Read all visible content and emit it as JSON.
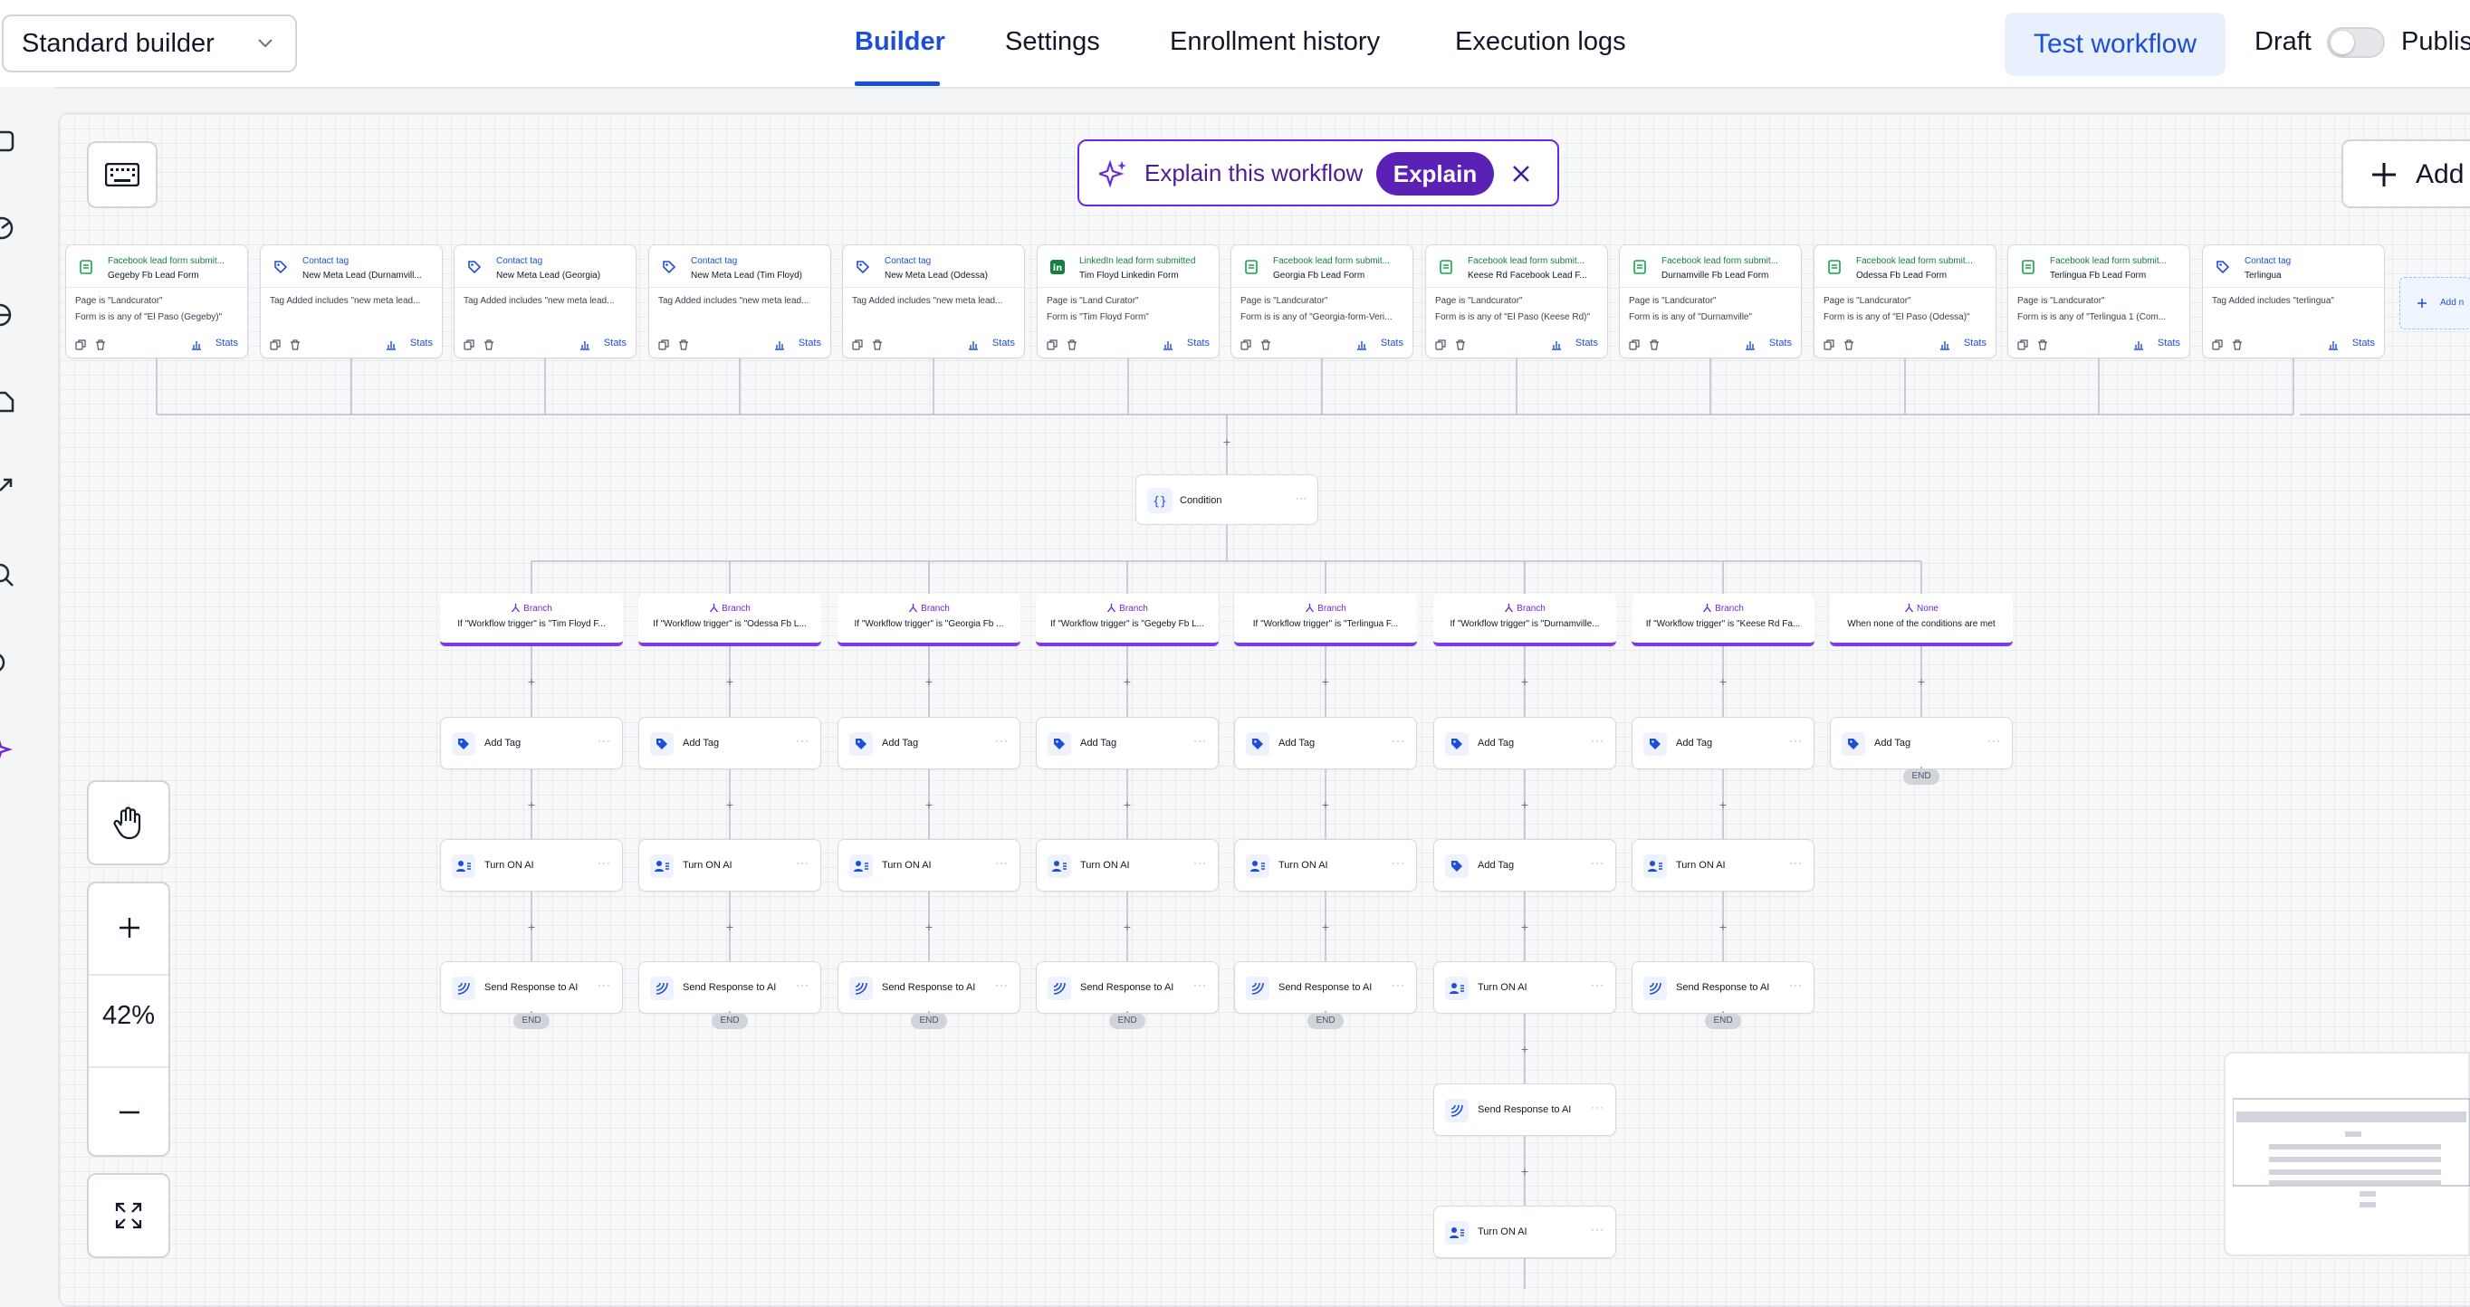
{
  "header": {
    "builder_select": "Standard builder",
    "tabs": [
      {
        "label": "Builder",
        "active": true
      },
      {
        "label": "Settings",
        "active": false
      },
      {
        "label": "Enrollment history",
        "active": false
      },
      {
        "label": "Execution logs",
        "active": false
      }
    ],
    "test_workflow": "Test workflow",
    "draft": "Draft",
    "publish": "Publis",
    "accent": "#1d4ed8"
  },
  "canvas": {
    "explain_prompt": "Explain this workflow",
    "explain_button": "Explain",
    "add_button": "Add",
    "add_trigger": "Add n",
    "triggers": [
      {
        "type": "Facebook lead form submit...",
        "name": "Gegeby Fb Lead Form",
        "line1": "Page is \"Landcurator\"",
        "line2": "Form is is any of \"El Paso (Gegeby)\"",
        "icon": "form",
        "stats": "Stats"
      },
      {
        "type": "Contact tag",
        "name": "New Meta Lead (Durnamvill...",
        "line1": "Tag Added includes \"new meta lead...",
        "line2": "",
        "icon": "tag",
        "stats": "Stats"
      },
      {
        "type": "Contact tag",
        "name": "New Meta Lead (Georgia)",
        "line1": "Tag Added includes \"new meta lead...",
        "line2": "",
        "icon": "tag",
        "stats": "Stats"
      },
      {
        "type": "Contact tag",
        "name": "New Meta Lead (Tim Floyd)",
        "line1": "Tag Added includes \"new meta lead...",
        "line2": "",
        "icon": "tag",
        "stats": "Stats"
      },
      {
        "type": "Contact tag",
        "name": "New Meta Lead (Odessa)",
        "line1": "Tag Added includes \"new meta lead...",
        "line2": "",
        "icon": "tag",
        "stats": "Stats"
      },
      {
        "type": "LinkedIn lead form submitted",
        "name": "Tim Floyd Linkedin Form",
        "line1": "Page is \"Land Curator\"",
        "line2": "Form is \"Tim Floyd Form\"",
        "icon": "linkedin",
        "stats": "Stats"
      },
      {
        "type": "Facebook lead form submit...",
        "name": "Georgia Fb Lead Form",
        "line1": "Page is \"Landcurator\"",
        "line2": "Form is is any of \"Georgia-form-Veri...",
        "icon": "form",
        "stats": "Stats"
      },
      {
        "type": "Facebook lead form submit...",
        "name": "Keese Rd Facebook Lead F...",
        "line1": "Page is \"Landcurator\"",
        "line2": "Form is is any of \"El Paso (Keese Rd)\"",
        "icon": "form",
        "stats": "Stats"
      },
      {
        "type": "Facebook lead form submit...",
        "name": "Durnamville Fb Lead Form",
        "line1": "Page is \"Landcurator\"",
        "line2": "Form is is any of \"Durnamville\"",
        "icon": "form",
        "stats": "Stats"
      },
      {
        "type": "Facebook lead form submit...",
        "name": "Odessa Fb Lead Form",
        "line1": "Page is \"Landcurator\"",
        "line2": "Form is is any of \"El Paso (Odessa)\"",
        "icon": "form",
        "stats": "Stats"
      },
      {
        "type": "Facebook lead form submit...",
        "name": "Terlingua Fb Lead Form",
        "line1": "Page is \"Landcurator\"",
        "line2": "Form is is any of \"Terlingua 1 (Com...",
        "icon": "form",
        "stats": "Stats"
      },
      {
        "type": "Contact tag",
        "name": "Terlingua",
        "line1": "Tag Added includes \"terlingua\"",
        "line2": "",
        "icon": "tag",
        "stats": "Stats"
      }
    ],
    "condition": "Condition",
    "branches": [
      {
        "title": "Branch",
        "desc": "If \"Workflow trigger\" is \"Tim Floyd F...",
        "steps": [
          "Add Tag",
          "Turn ON AI",
          "Send Response to AI"
        ]
      },
      {
        "title": "Branch",
        "desc": "If \"Workflow trigger\" is \"Odessa Fb L...",
        "steps": [
          "Add Tag",
          "Turn ON AI",
          "Send Response to AI"
        ]
      },
      {
        "title": "Branch",
        "desc": "If \"Workflow trigger\" is \"Georgia Fb ...",
        "steps": [
          "Add Tag",
          "Turn ON AI",
          "Send Response to AI"
        ]
      },
      {
        "title": "Branch",
        "desc": "If \"Workflow trigger\" is \"Gegeby Fb L...",
        "steps": [
          "Add Tag",
          "Turn ON AI",
          "Send Response to AI"
        ]
      },
      {
        "title": "Branch",
        "desc": "If \"Workflow trigger\" is \"Terlingua F...",
        "steps": [
          "Add Tag",
          "Turn ON AI",
          "Send Response to AI"
        ]
      },
      {
        "title": "Branch",
        "desc": "If \"Workflow trigger\" is \"Durnamville...",
        "steps": [
          "Add Tag",
          "Add Tag",
          "Turn ON AI",
          "Send Response to AI",
          "Turn ON AI"
        ]
      },
      {
        "title": "Branch",
        "desc": "If \"Workflow trigger\" is \"Keese Rd Fa...",
        "steps": [
          "Add Tag",
          "Turn ON AI",
          "Send Response to AI"
        ]
      },
      {
        "title": "None",
        "desc": "When none of the conditions are met",
        "steps": [
          "Add Tag"
        ]
      }
    ],
    "end_label": "END",
    "zoom": "42%",
    "branch_accent": "#7c3aed"
  }
}
